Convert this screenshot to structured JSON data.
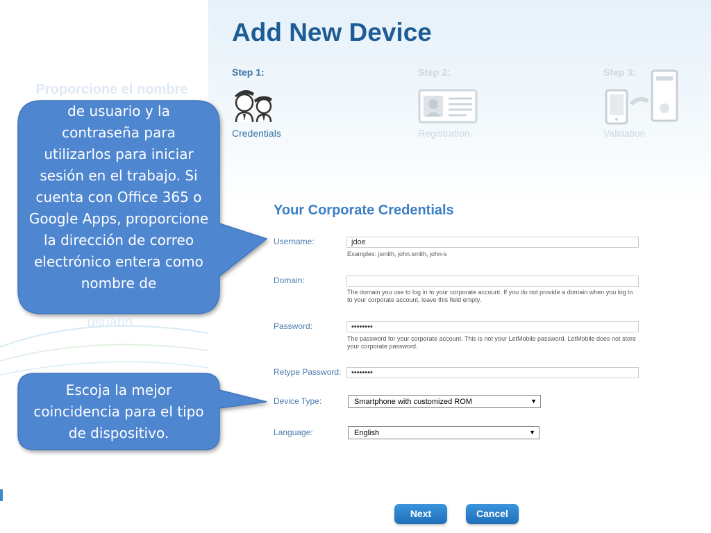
{
  "page": {
    "title": "Add New Device"
  },
  "steps": [
    {
      "label": "Step 1:",
      "caption": "Credentials",
      "active": true,
      "icon": "users-icon"
    },
    {
      "label": "Step 2:",
      "caption": "Registration",
      "active": false,
      "icon": "id-card-icon"
    },
    {
      "label": "Step 3:",
      "caption": "Validation",
      "active": false,
      "icon": "devices-icon"
    }
  ],
  "form": {
    "section_title": "Your Corporate Credentials",
    "username": {
      "label": "Username:",
      "value": "jdoe",
      "hint": "Examples: jsmith, john.smith, john-s"
    },
    "domain": {
      "label": "Domain:",
      "value": "",
      "hint": "The domain you use to log in to your corporate account. If you do not provide a domain when you log in to your corporate account, leave this field empty."
    },
    "password": {
      "label": "Password:",
      "value": "••••••••",
      "hint": "The password for your corporate account. This is not your LetMobile password. LetMobile does not store your corporate password."
    },
    "retype_password": {
      "label": "Retype Password:",
      "value": "••••••••"
    },
    "device_type": {
      "label": "Device Type:",
      "selected": "Smartphone with customized ROM"
    },
    "language": {
      "label": "Language:",
      "selected": "English"
    }
  },
  "buttons": {
    "next": "Next",
    "cancel": "Cancel"
  },
  "callouts": {
    "credentials_ghost_top": "Proporcione el nombre",
    "credentials_ghost_bottom": "usuario.",
    "credentials_text": "de usuario y la contraseña para utilizarlos para iniciar sesión en el trabajo. Si cuenta con Office 365 o Google Apps, proporcione la dirección de correo electrónico entera como nombre de",
    "device_text": "Escoja la mejor coincidencia para el tipo de dispositivo."
  },
  "colors": {
    "title": "#1e5c95",
    "section_title": "#3b7fc4",
    "label": "#4a7bb0",
    "callout": "#4f86d0",
    "button": "#2a82cc"
  }
}
